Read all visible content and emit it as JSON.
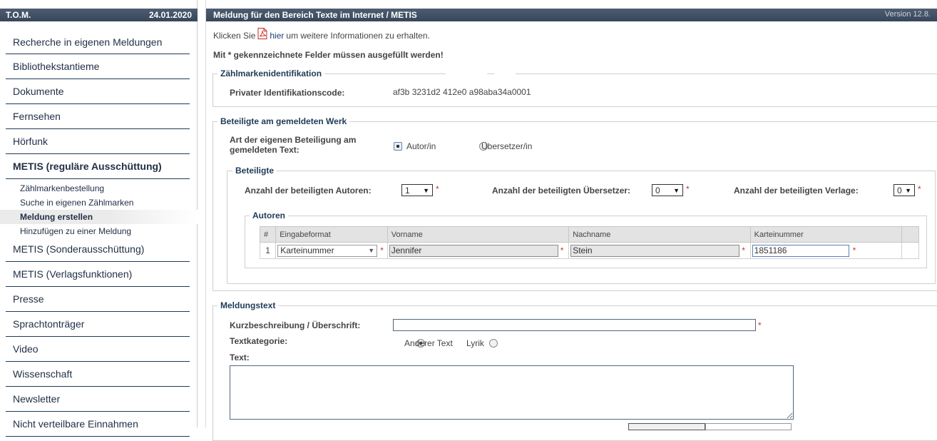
{
  "sidebar": {
    "app_name": "T.O.M.",
    "date": "24.01.2020",
    "items": [
      {
        "label": "Recherche in eigenen Meldungen"
      },
      {
        "label": "Bibliothekstantieme"
      },
      {
        "label": "Dokumente"
      },
      {
        "label": "Fernsehen"
      },
      {
        "label": "Hörfunk"
      },
      {
        "label": "METIS (reguläre Ausschüttung)"
      },
      {
        "label": "METIS (Sonderausschüttung)"
      },
      {
        "label": "METIS (Verlagsfunktionen)"
      },
      {
        "label": "Presse"
      },
      {
        "label": "Sprachtonträger"
      },
      {
        "label": "Video"
      },
      {
        "label": "Wissenschaft"
      },
      {
        "label": "Newsletter"
      },
      {
        "label": "Nicht verteilbare Einnahmen"
      }
    ],
    "sub_items": [
      {
        "label": "Zählmarkenbestellung"
      },
      {
        "label": "Suche in eigenen Zählmarken"
      },
      {
        "label": "Meldung erstellen"
      },
      {
        "label": "Hinzufügen zu einer Meldung"
      }
    ]
  },
  "header": {
    "title": "Meldung für den Bereich Texte im Internet / METIS",
    "version": "Version 12.8."
  },
  "intro": {
    "prefix": "Klicken Sie",
    "link": "hier",
    "suffix": "um weitere Informationen zu erhalten.",
    "required_note": "Mit * gekennzeichnete Felder müssen ausgefüllt werden!"
  },
  "identification": {
    "legend": "Zählmarkenidentifikation",
    "label": "Privater Identifikationscode:",
    "value": "af3b 3231d2 412e0 a98aba34a0001"
  },
  "participants": {
    "legend": "Beteiligte am gemeldeten Werk",
    "question_line1": "Art der eigenen Beteiligung am",
    "question_line2": "gemeldeten Text:",
    "options": [
      "Autor/in",
      "Übersetzer/in"
    ],
    "beteiligte_legend": "Beteiligte",
    "authors_label": "Anzahl der beteiligten Autoren:",
    "authors_value": "1",
    "translators_label": "Anzahl der beteiligten Übersetzer:",
    "translators_value": "0",
    "publishers_label": "Anzahl der beteiligten Verlage:",
    "publishers_value": "0",
    "required_mark": "*",
    "authors_legend": "Autoren",
    "table": {
      "headers": [
        "#",
        "Eingabeformat",
        "Vorname",
        "Nachname",
        "Karteinummer"
      ],
      "rows": [
        {
          "num": "1",
          "format": "Karteinummer",
          "first": "Jennifer",
          "last": "Stein",
          "file_no": "1851186"
        }
      ]
    }
  },
  "message": {
    "legend": "Meldungstext",
    "short_label": "Kurzbeschreibung / Überschrift:",
    "short_value": "",
    "category_label": "Textkategorie:",
    "category_options": [
      "Anderer Text",
      "Lyrik"
    ],
    "text_label": "Text:"
  },
  "colors": {
    "header_bg": "#3f4d62",
    "nav_text": "#1f2f45",
    "legend_text": "#1f3a57",
    "required": "#c0392b"
  }
}
